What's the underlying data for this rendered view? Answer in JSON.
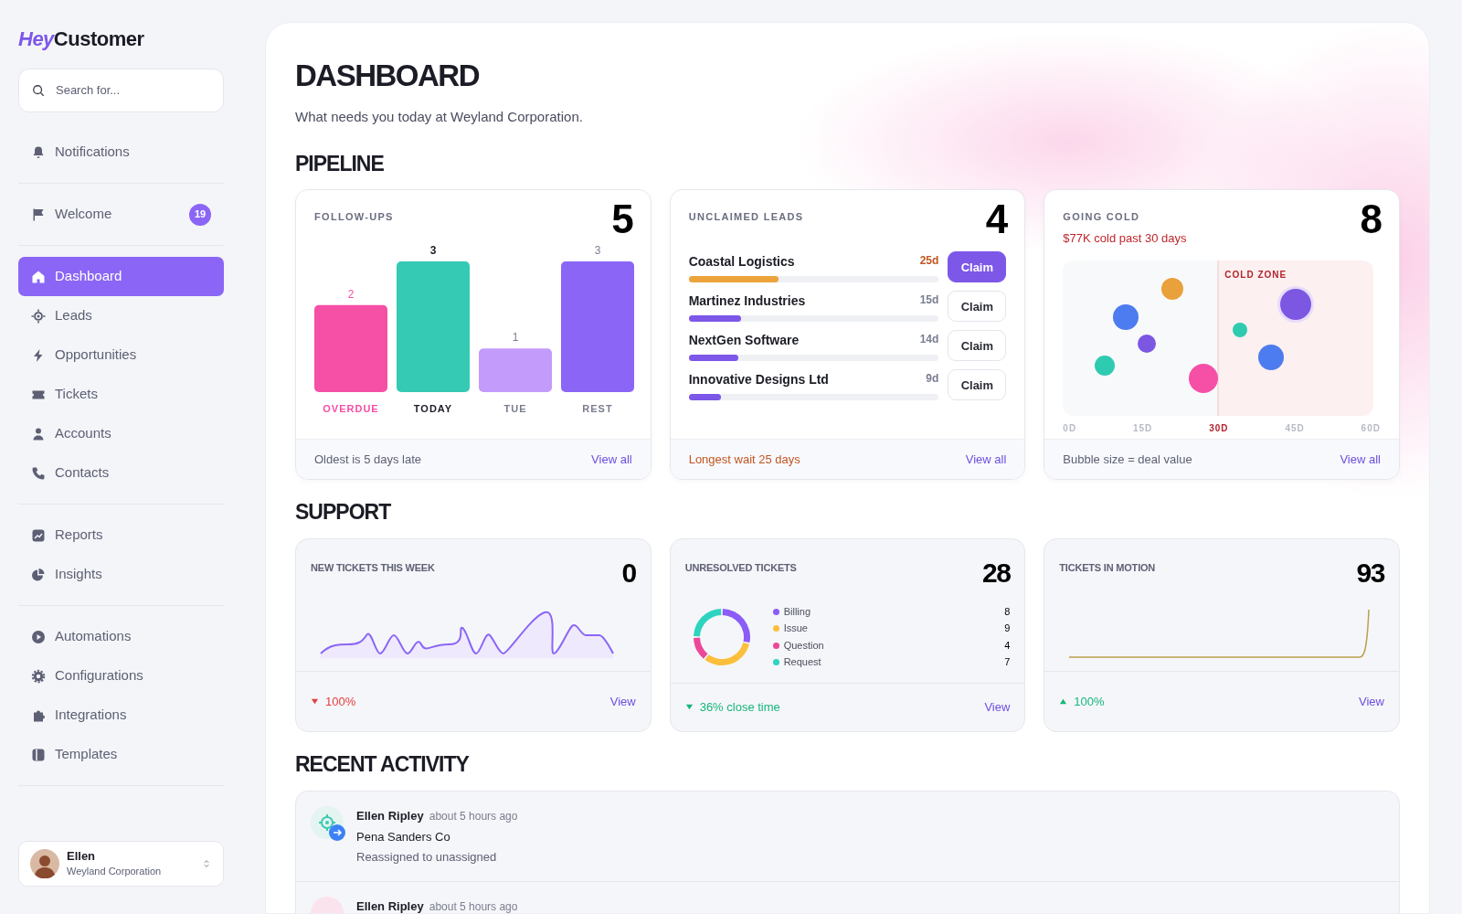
{
  "brand": {
    "accent": "Hey",
    "name": "Customer"
  },
  "search": {
    "placeholder": "Search for..."
  },
  "sidebar": {
    "groups": [
      {
        "items": [
          {
            "label": "Notifications",
            "selected": false
          }
        ]
      },
      {
        "items": [
          {
            "label": "Welcome",
            "selected": false,
            "badge": "19"
          }
        ]
      },
      {
        "items": [
          {
            "label": "Dashboard",
            "selected": true
          },
          {
            "label": "Leads",
            "selected": false
          },
          {
            "label": "Opportunities",
            "selected": false
          },
          {
            "label": "Tickets",
            "selected": false
          },
          {
            "label": "Accounts",
            "selected": false
          },
          {
            "label": "Contacts",
            "selected": false
          }
        ]
      },
      {
        "items": [
          {
            "label": "Reports",
            "selected": false
          },
          {
            "label": "Insights",
            "selected": false
          }
        ]
      },
      {
        "items": [
          {
            "label": "Automations",
            "selected": false
          },
          {
            "label": "Configurations",
            "selected": false
          },
          {
            "label": "Integrations",
            "selected": false
          },
          {
            "label": "Templates",
            "selected": false
          }
        ]
      }
    ]
  },
  "user": {
    "name": "Ellen",
    "org": "Weyland Corporation"
  },
  "page": {
    "title": "DASHBOARD",
    "subtitle": "What needs you today at Weyland Corporation."
  },
  "pipeline": {
    "title": "PIPELINE",
    "follow_ups": {
      "label": "FOLLOW-UPS",
      "count": "5",
      "chart_data": {
        "type": "bar",
        "categories": [
          "OVERDUE",
          "TODAY",
          "TUE",
          "REST"
        ],
        "values": [
          2,
          3,
          1,
          3
        ],
        "colors": [
          "#f64fa6",
          "#34cab4",
          "#c39bfb",
          "#8b66f6"
        ],
        "ylim": [
          0,
          3
        ],
        "data_labels": true
      },
      "footer": "Oldest is 5 days late",
      "link": "View all"
    },
    "unclaimed_leads": {
      "label": "UNCLAIMED LEADS",
      "count": "4",
      "items": [
        {
          "name": "Coastal Logistics",
          "age": "25d",
          "level": 0.36,
          "urgent": true,
          "action": "Claim"
        },
        {
          "name": "Martinez Industries",
          "age": "15d",
          "level": 0.21,
          "urgent": false,
          "action": "Claim"
        },
        {
          "name": "NextGen Software",
          "age": "14d",
          "level": 0.2,
          "urgent": false,
          "action": "Claim"
        },
        {
          "name": "Innovative Designs Ltd",
          "age": "9d",
          "level": 0.13,
          "urgent": false,
          "action": "Claim"
        }
      ],
      "footer": "Longest wait 25 days",
      "link": "View all"
    },
    "going_cold": {
      "label": "GOING COLD",
      "subtitle": "$77K cold past 30 days",
      "count": "8",
      "zone_label": "COLD ZONE",
      "ticks": [
        {
          "label": "0D",
          "highlighted": false
        },
        {
          "label": "15D",
          "highlighted": false
        },
        {
          "label": "30D",
          "highlighted": true
        },
        {
          "label": "45D",
          "highlighted": false
        },
        {
          "label": "60D",
          "highlighted": false
        }
      ],
      "footer": "Bubble size = deal value",
      "link": "View all"
    }
  },
  "support": {
    "title": "SUPPORT",
    "cards": [
      {
        "kind": "sparkline",
        "label": "NEW TICKETS THIS WEEK",
        "count": "0",
        "change": {
          "rising": false,
          "good": false,
          "text": "100%"
        },
        "link": "View"
      },
      {
        "kind": "donut",
        "label": "UNRESOLVED TICKETS",
        "count": "28",
        "chart_data": {
          "type": "donut",
          "categories": [
            "Billing",
            "Issue",
            "Question",
            "Request"
          ],
          "values": [
            8,
            9,
            4,
            7
          ],
          "colors": [
            "#8b5cf6",
            "#fbbf3c",
            "#ec4899",
            "#2dd4bf"
          ],
          "value_labels": [
            "8",
            "9",
            "4",
            "7"
          ],
          "legend": "right"
        },
        "change": {
          "rising": false,
          "good": true,
          "text": "36% close time"
        },
        "link": "View"
      },
      {
        "kind": "sparkline",
        "label": "TICKETS IN MOTION",
        "count": "93",
        "change": {
          "rising": true,
          "good": true,
          "text": "100%"
        },
        "link": "View"
      }
    ]
  },
  "recent_activity": {
    "title": "RECENT ACTIVITY",
    "items": [
      {
        "user": "Ellen Ripley",
        "time": "about 5 hours ago",
        "subject": "Pena Sanders Co",
        "action": "Reassigned to unassigned"
      },
      {
        "user": "Ellen Ripley",
        "time": "about 5 hours ago"
      }
    ]
  }
}
